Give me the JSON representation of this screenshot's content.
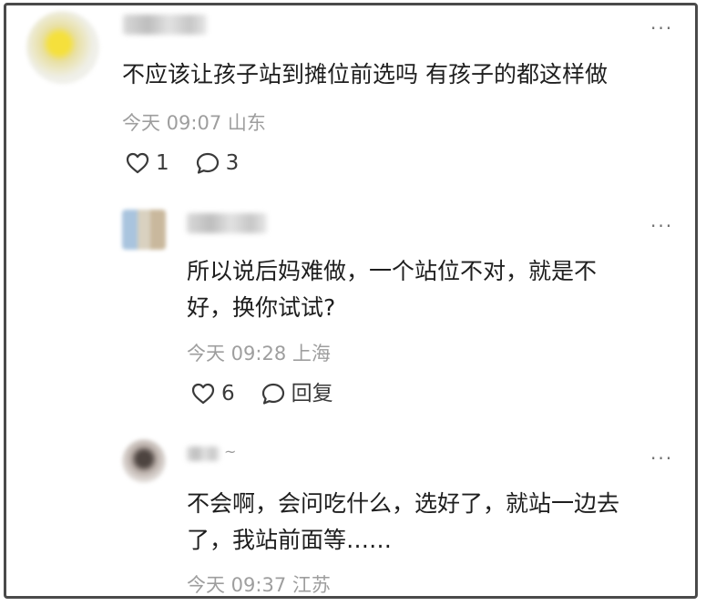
{
  "comments": [
    {
      "name": "",
      "text_lines": [
        "不应该让孩子站到摊位前选吗 有孩子的都这样做"
      ],
      "time": "今天 09:07",
      "location": "山东",
      "likes": "1",
      "reply_label": "3",
      "more_label": "···"
    },
    {
      "name": "",
      "text_lines": [
        "所以说后妈难做，一个站位不对，就是不",
        "好，换你试试?"
      ],
      "time": "今天 09:28",
      "location": "上海",
      "likes": "6",
      "reply_label": "回复",
      "more_label": "···"
    },
    {
      "name": "~",
      "text_lines": [
        "不会啊，会问吃什么，选好了，就站一边去",
        "了，我站前面等……"
      ],
      "time": "今天 09:37",
      "location": "江苏",
      "more_label": "···"
    }
  ],
  "icons": {
    "like": "heart-outline-icon",
    "reply": "speech-bubble-outline-icon",
    "more": "more-dots-icon"
  },
  "colors": {
    "text": "#1e1e1e",
    "meta": "#9e9e9e",
    "icon": "#3a3a3a",
    "frame": "#4a4a4a"
  }
}
